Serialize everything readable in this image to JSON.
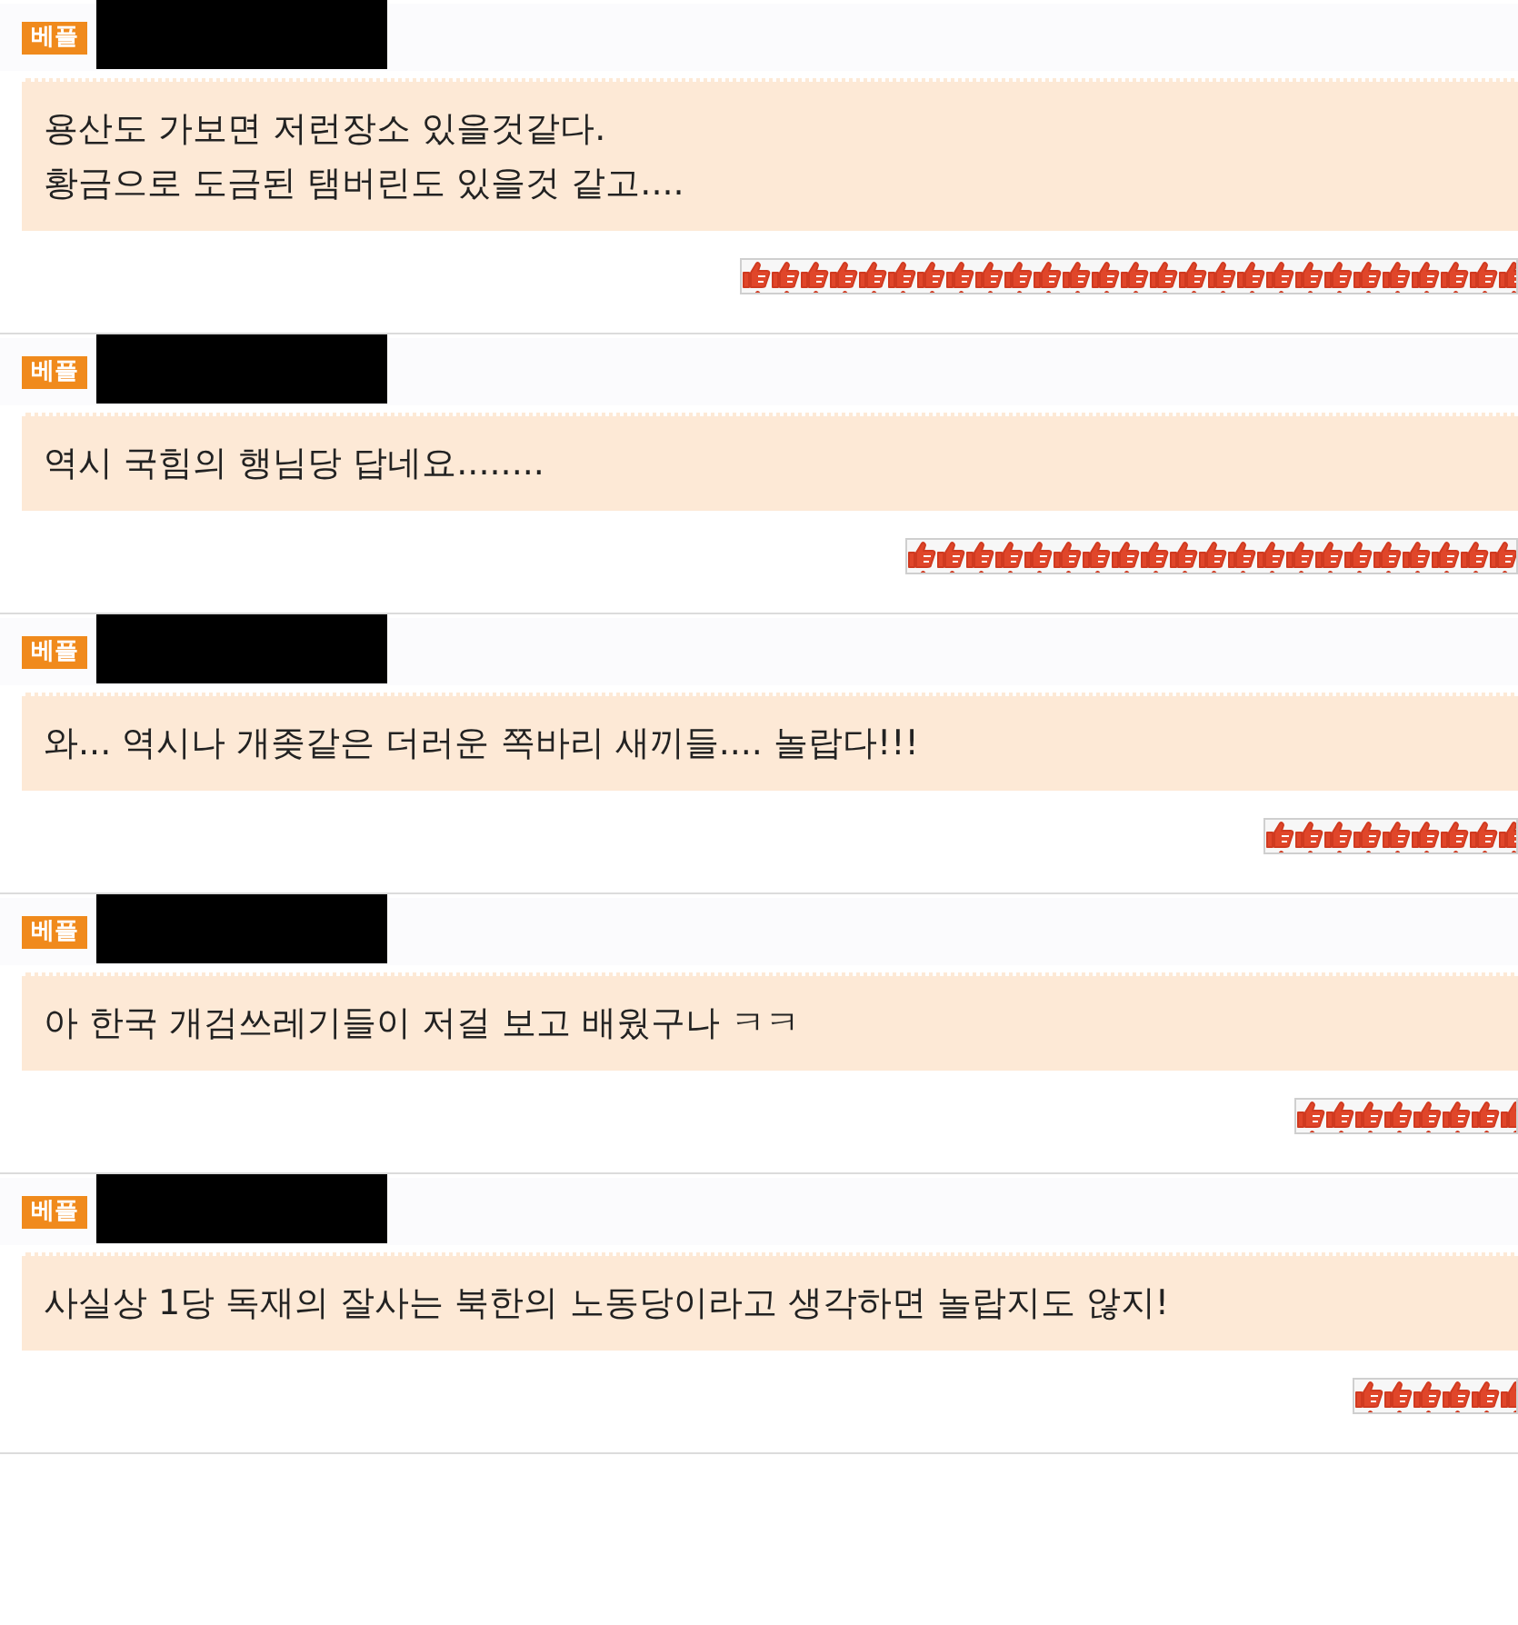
{
  "comments": [
    {
      "badge": "베플",
      "text": "용산도 가보면 저런장소 있을것같다.\n황금으로 도금된 탬버린도 있을것 같고....",
      "level": 0.52
    },
    {
      "badge": "베플",
      "text": "역시 국힘의 행님당 답네요........",
      "level": 0.41
    },
    {
      "badge": "베플",
      "text": "와... 역시나 개좆같은 더러운 쪽바리 새끼들.... 놀랍다!!!",
      "level": 0.17
    },
    {
      "badge": "베플",
      "text": "아 한국 개검쓰레기들이 저걸 보고 배웠구나 ㅋㅋ",
      "level": 0.15
    },
    {
      "badge": "베플",
      "text": "사실상 1당 독재의 잘사는 북한의 노동당이라고 생각하면 놀랍지도 않지!",
      "level": 0.11
    }
  ]
}
